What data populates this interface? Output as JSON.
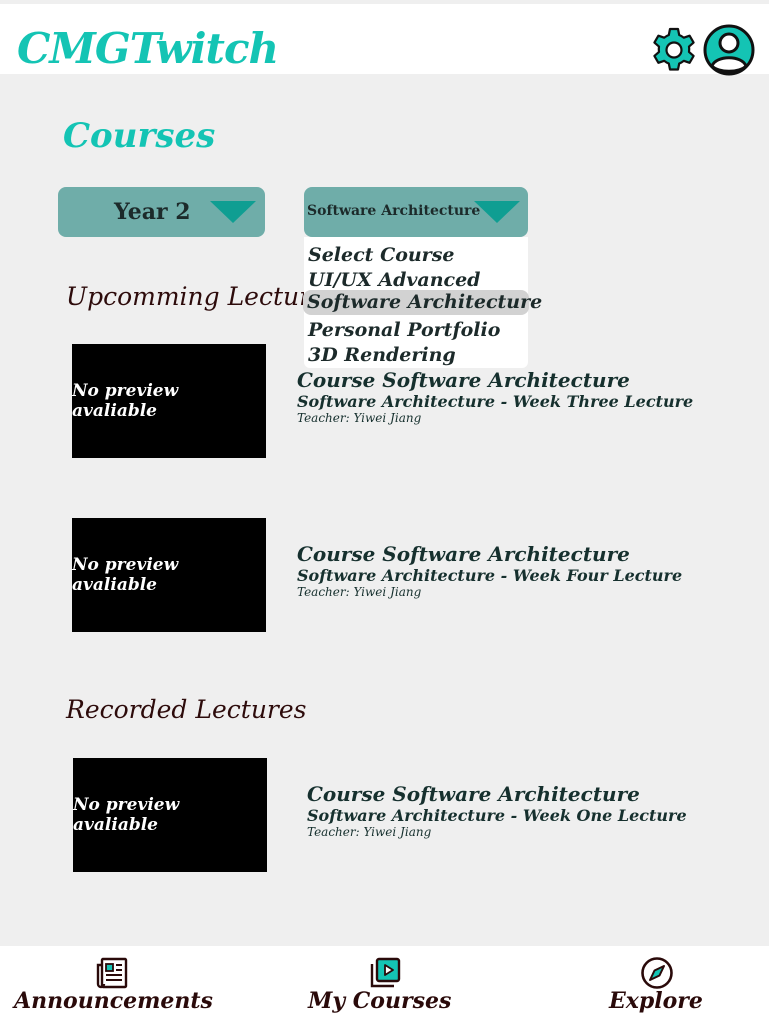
{
  "header": {
    "app_title": "CMGTwitch",
    "settings_icon": "gear-icon",
    "profile_icon": "account-circle-icon",
    "accent_color": "#14c4b4"
  },
  "page": {
    "title": "Courses"
  },
  "filters": {
    "year": {
      "selected": "Year 2"
    },
    "course": {
      "selected": "Software Architecture",
      "options": [
        "Select Course",
        "UI/UX Advanced",
        "Software Architecture",
        "Personal Portfolio",
        "3D Rendering"
      ],
      "highlighted_option": "Software Architecture"
    }
  },
  "upcoming": {
    "title": "Upcomming Lectur",
    "items": [
      {
        "preview": "No preview avaliable",
        "course": "Course Software Architecture",
        "lecture": "Software Architecture - Week Three Lecture",
        "teacher": "Teacher: Yiwei Jiang"
      },
      {
        "preview": "No preview avaliable",
        "course": "Course Software Architecture",
        "lecture": "Software Architecture - Week Four Lecture",
        "teacher": "Teacher: Yiwei Jiang"
      }
    ]
  },
  "recorded": {
    "title": "Recorded Lectures",
    "items": [
      {
        "preview": "No preview avaliable",
        "course": "Course Software Architecture",
        "lecture": "Software Architecture - Week One Lecture",
        "teacher": "Teacher: Yiwei Jiang"
      }
    ]
  },
  "bottom_nav": {
    "items": [
      {
        "label": "Announcements",
        "icon": "newspaper-icon"
      },
      {
        "label": "My Courses",
        "icon": "video-library-icon"
      },
      {
        "label": "Explore",
        "icon": "compass-icon"
      }
    ]
  }
}
